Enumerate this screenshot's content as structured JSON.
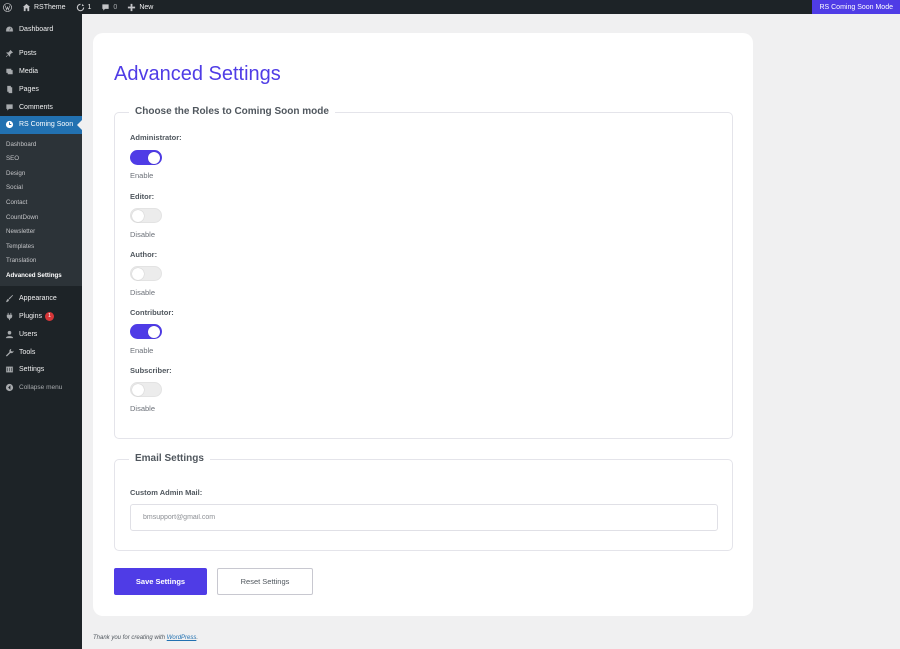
{
  "adminbar": {
    "site_name": "RSTheme",
    "updates_count": "1",
    "comments_count": "0",
    "new_label": "New",
    "right_label": "RS Coming Soon Mode"
  },
  "sidebar": {
    "items_top": [
      {
        "label": "Dashboard",
        "icon": "dashboard-icon"
      }
    ],
    "items_mid": [
      {
        "label": "Posts",
        "icon": "pin-icon"
      },
      {
        "label": "Media",
        "icon": "media-icon"
      },
      {
        "label": "Pages",
        "icon": "pages-icon"
      },
      {
        "label": "Comments",
        "icon": "comment-icon"
      }
    ],
    "active": {
      "label": "RS Coming Soon",
      "icon": "clock-icon"
    },
    "submenu": [
      "Dashboard",
      "SEO",
      "Design",
      "Social",
      "Contact",
      "CountDown",
      "Newsletter",
      "Templates",
      "Translation",
      "Advanced Settings"
    ],
    "submenu_current": "Advanced Settings",
    "items_bottom": [
      {
        "label": "Appearance",
        "icon": "brush-icon"
      },
      {
        "label": "Plugins",
        "icon": "plugin-icon",
        "badge": "1"
      },
      {
        "label": "Users",
        "icon": "users-icon"
      },
      {
        "label": "Tools",
        "icon": "wrench-icon"
      },
      {
        "label": "Settings",
        "icon": "settings-icon"
      }
    ],
    "collapse_label": "Collapse menu"
  },
  "main": {
    "title": "Advanced Settings",
    "roles_legend": "Choose the Roles to Coming Soon mode",
    "roles": [
      {
        "label": "Administrator:",
        "enabled": true,
        "state": "Enable"
      },
      {
        "label": "Editor:",
        "enabled": false,
        "state": "Disable"
      },
      {
        "label": "Author:",
        "enabled": false,
        "state": "Disable"
      },
      {
        "label": "Contributor:",
        "enabled": true,
        "state": "Enable"
      },
      {
        "label": "Subscriber:",
        "enabled": false,
        "state": "Disable"
      }
    ],
    "email_legend": "Email Settings",
    "mail_label": "Custom Admin Mail:",
    "mail_value": "",
    "mail_placeholder": "bmsupport@gmail.com",
    "save_label": "Save Settings",
    "reset_label": "Reset Settings"
  },
  "footer": {
    "text": "Thank you for creating with ",
    "link": "WordPress",
    "suffix": "."
  },
  "colors": {
    "accent": "#4f3ce6",
    "admin_dark": "#1d2327",
    "active_blue": "#2271b1"
  }
}
